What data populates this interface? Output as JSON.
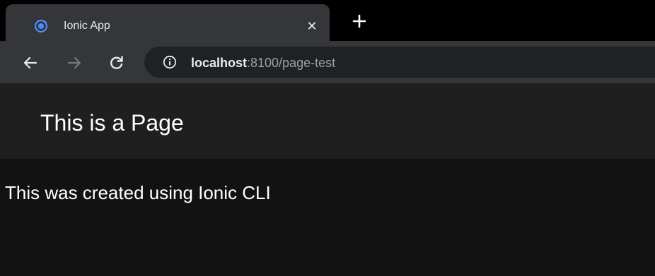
{
  "browser": {
    "tab": {
      "title": "Ionic App",
      "favicon_icon": "ionic-logo-icon",
      "close_symbol": "✕"
    },
    "toolbar": {
      "back_icon": "arrow-left-icon",
      "forward_icon": "arrow-right-icon",
      "reload_icon": "reload-icon",
      "site_info_icon": "info-icon",
      "url_host": "localhost",
      "url_rest": ":8100/page-test"
    },
    "colors": {
      "accent": "#4d8dff",
      "tab_bg": "#35363a",
      "tab_strip_bg": "#000000",
      "omnibox_bg": "#202124",
      "header_bg": "#1f1f1f",
      "content_bg": "#121212"
    }
  },
  "page": {
    "header": {
      "title": "This is a Page"
    },
    "content": {
      "text": "This was created using Ionic CLI"
    }
  }
}
